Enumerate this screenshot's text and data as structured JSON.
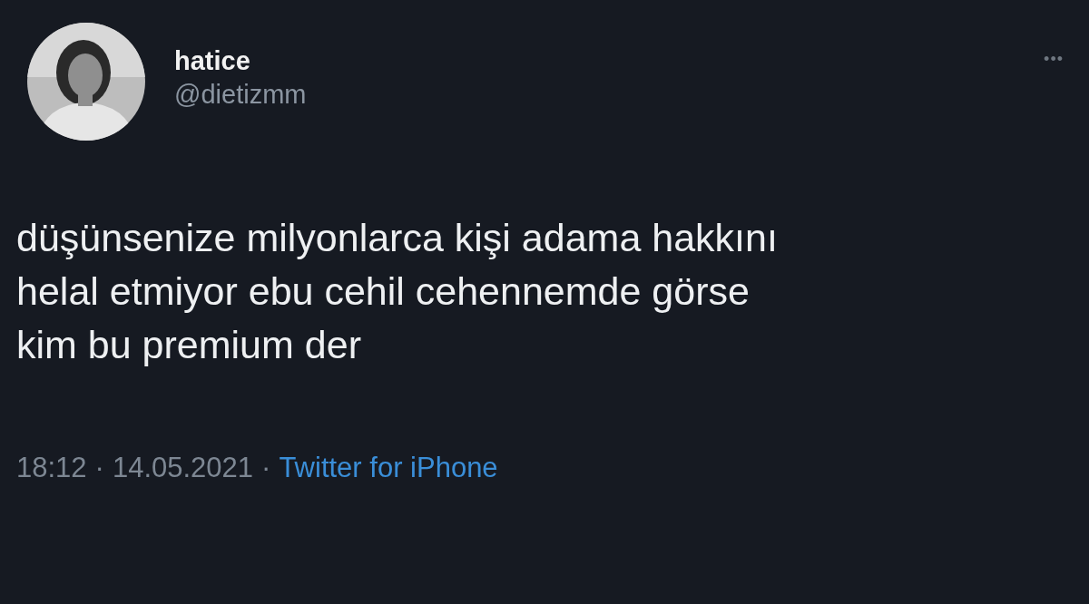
{
  "author": {
    "name": "hatice",
    "handle": "@dietizmm"
  },
  "menu": {
    "glyph": "•••"
  },
  "tweet": {
    "lines": [
      "düşünsenize milyonlarca kişi adama hakkını",
      "helal etmiyor ebu cehil cehennemde görse",
      "kim bu premium der"
    ]
  },
  "footer": {
    "time": "18:12",
    "separator_1": "·",
    "date": "14.05.2021",
    "separator_2": "·",
    "source": "Twitter for iPhone"
  }
}
